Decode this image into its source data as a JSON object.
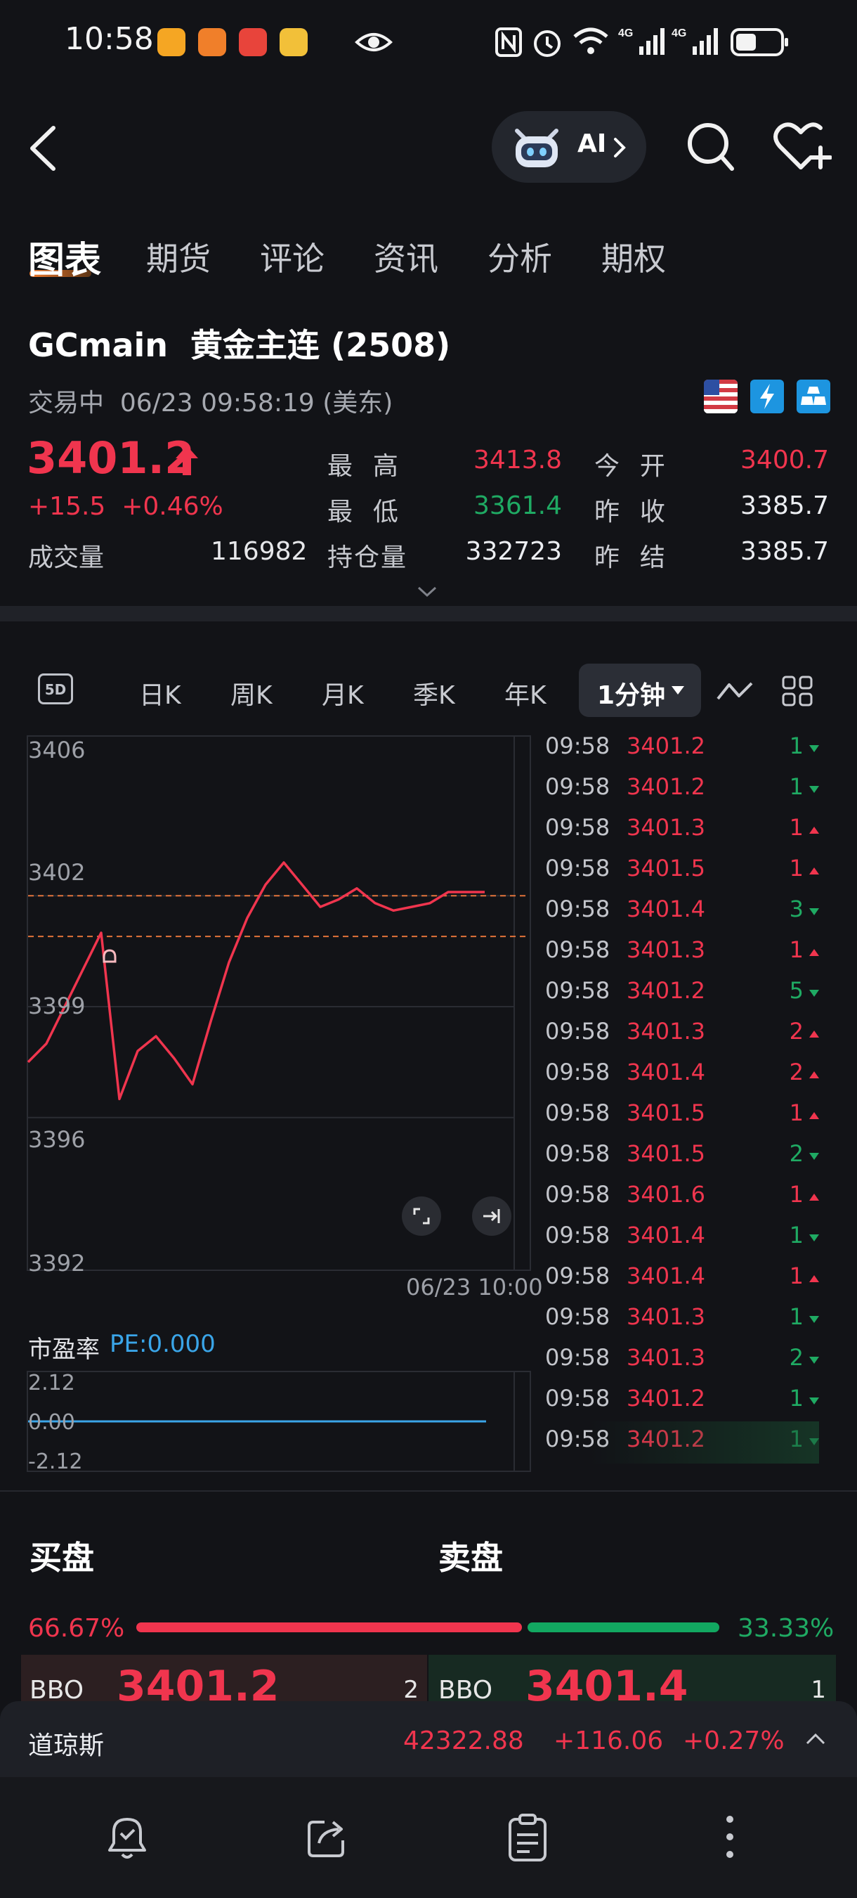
{
  "status_bar": {
    "time": "10:58",
    "icons": [
      "app-badge-orange",
      "app-badge-orange-2",
      "app-badge-red",
      "app-badge-yellow",
      "eye-icon",
      "nfc-icon",
      "alarm-icon",
      "wifi-icon",
      "signal-4g-icon",
      "signal-4g-icon-2",
      "battery-icon"
    ]
  },
  "header": {
    "ai_label": "AI"
  },
  "tabs": [
    {
      "label": "图表"
    },
    {
      "label": "期货"
    },
    {
      "label": "评论"
    },
    {
      "label": "资讯"
    },
    {
      "label": "分析"
    },
    {
      "label": "期权"
    }
  ],
  "quote": {
    "title": "GCmain  黄金主连 (2508)",
    "status": "交易中  06/23 09:58:19 (美东)",
    "price": "3401.2",
    "change": "+15.5  +0.46%",
    "volume_label": "成交量",
    "volume_value": "116982",
    "high_label": "最  高",
    "high_value": "3413.8",
    "low_label": "最  低",
    "low_value": "3361.4",
    "oi_label": "持仓量",
    "oi_value": "332723",
    "open_label": "今  开",
    "open_value": "3400.7",
    "prev_close_label": "昨  收",
    "prev_close_value": "3385.7",
    "prev_settle_label": "昨  结",
    "prev_settle_value": "3385.7"
  },
  "periods": {
    "fiveday": "5D",
    "day": "日K",
    "week": "周K",
    "month": "月K",
    "quarter": "季K",
    "year": "年K",
    "selected": "1分钟"
  },
  "chart": {
    "y_ticks": [
      "3406",
      "3402",
      "3399",
      "3396",
      "3392"
    ],
    "x_label": "06/23 10:00"
  },
  "chart_data": {
    "type": "line",
    "ylim": [
      3392,
      3406
    ],
    "series": [
      {
        "values": [
          3397.5,
          3398.0,
          3399.0,
          3400.0,
          3401.0,
          3396.5,
          3397.8,
          3398.2,
          3397.6,
          3396.9,
          3398.6,
          3400.2,
          3401.4,
          3402.3,
          3402.9,
          3402.3,
          3401.7,
          3401.9,
          3402.2,
          3401.8,
          3401.6,
          3401.7,
          3401.8,
          3402.1,
          3402.1,
          3402.1
        ]
      }
    ],
    "reference_lines": [
      3402.0,
      3400.9
    ]
  },
  "ticks": [
    {
      "time": "09:58",
      "price": "3401.2",
      "vol": "1",
      "dir": "down"
    },
    {
      "time": "09:58",
      "price": "3401.2",
      "vol": "1",
      "dir": "down"
    },
    {
      "time": "09:58",
      "price": "3401.3",
      "vol": "1",
      "dir": "up"
    },
    {
      "time": "09:58",
      "price": "3401.5",
      "vol": "1",
      "dir": "up"
    },
    {
      "time": "09:58",
      "price": "3401.4",
      "vol": "3",
      "dir": "down"
    },
    {
      "time": "09:58",
      "price": "3401.3",
      "vol": "1",
      "dir": "up"
    },
    {
      "time": "09:58",
      "price": "3401.2",
      "vol": "5",
      "dir": "down"
    },
    {
      "time": "09:58",
      "price": "3401.3",
      "vol": "2",
      "dir": "up"
    },
    {
      "time": "09:58",
      "price": "3401.4",
      "vol": "2",
      "dir": "up"
    },
    {
      "time": "09:58",
      "price": "3401.5",
      "vol": "1",
      "dir": "up"
    },
    {
      "time": "09:58",
      "price": "3401.5",
      "vol": "2",
      "dir": "down"
    },
    {
      "time": "09:58",
      "price": "3401.6",
      "vol": "1",
      "dir": "up"
    },
    {
      "time": "09:58",
      "price": "3401.4",
      "vol": "1",
      "dir": "down"
    },
    {
      "time": "09:58",
      "price": "3401.4",
      "vol": "1",
      "dir": "up"
    },
    {
      "time": "09:58",
      "price": "3401.3",
      "vol": "1",
      "dir": "down"
    },
    {
      "time": "09:58",
      "price": "3401.3",
      "vol": "2",
      "dir": "down"
    },
    {
      "time": "09:58",
      "price": "3401.2",
      "vol": "1",
      "dir": "down"
    },
    {
      "time": "09:58",
      "price": "3401.2",
      "vol": "1",
      "dir": "down"
    }
  ],
  "pe": {
    "label": "市盈率",
    "value": "PE:0.000",
    "ticks": [
      "2.12",
      "0.00",
      "-2.12"
    ]
  },
  "orderbook": {
    "buy_title": "买盘",
    "sell_title": "卖盘",
    "buy_pct": "66.67%",
    "sell_pct": "33.33%",
    "buy_ratio": 0.6667,
    "bid_label": "BBO",
    "bid_price": "3401.2",
    "bid_qty": "2",
    "ask_label": "BBO",
    "ask_price": "3401.4",
    "ask_qty": "1"
  },
  "ticker": {
    "name": "道琼斯",
    "value": "42322.88",
    "change": "+116.06",
    "pct": "+0.27%"
  },
  "bottom_nav": [
    "alarm-clock-icon",
    "share-icon",
    "clipboard-icon",
    "more-icon"
  ],
  "colors": {
    "up": "#f0354e",
    "down": "#1faa63",
    "background": "#121317",
    "pe_line": "#3aa5e8"
  }
}
